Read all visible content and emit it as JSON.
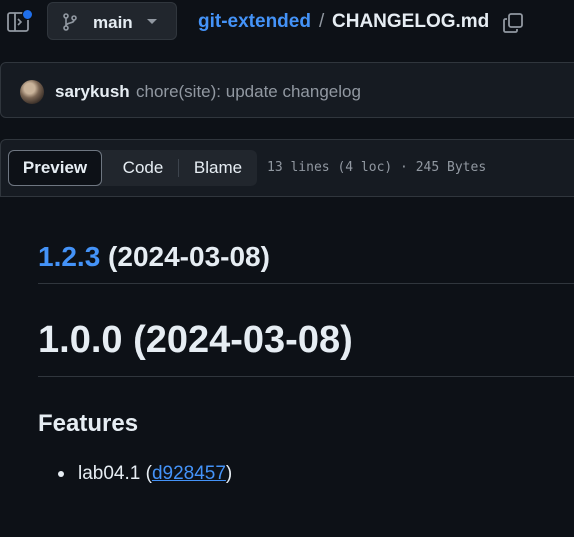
{
  "topbar": {
    "branch": "main",
    "repo": "git-extended",
    "separator": "/",
    "file": "CHANGELOG.md",
    "icons": [
      "sidebar-toggle-icon",
      "git-branch-icon",
      "caret-down-icon",
      "copy-icon"
    ]
  },
  "commit": {
    "author": "sarykush",
    "message": "chore(site): update changelog"
  },
  "file_header": {
    "tabs": [
      "Preview",
      "Code",
      "Blame"
    ],
    "active_tab": "Preview",
    "info": "13 lines (4 loc) · 245 Bytes"
  },
  "content": {
    "h2_link": "1.2.3",
    "h2_rest": " (2024-03-08)",
    "h1": "1.0.0 (2024-03-08)",
    "h3": "Features",
    "list": [
      {
        "prefix": "lab04.1 (",
        "link": "d928457",
        "suffix": ")"
      }
    ]
  },
  "colors": {
    "background": "#0d1117",
    "panel": "#161b22",
    "border": "#30363d",
    "link": "#4493f8",
    "text": "#e6edf3",
    "muted": "#9198a1"
  }
}
